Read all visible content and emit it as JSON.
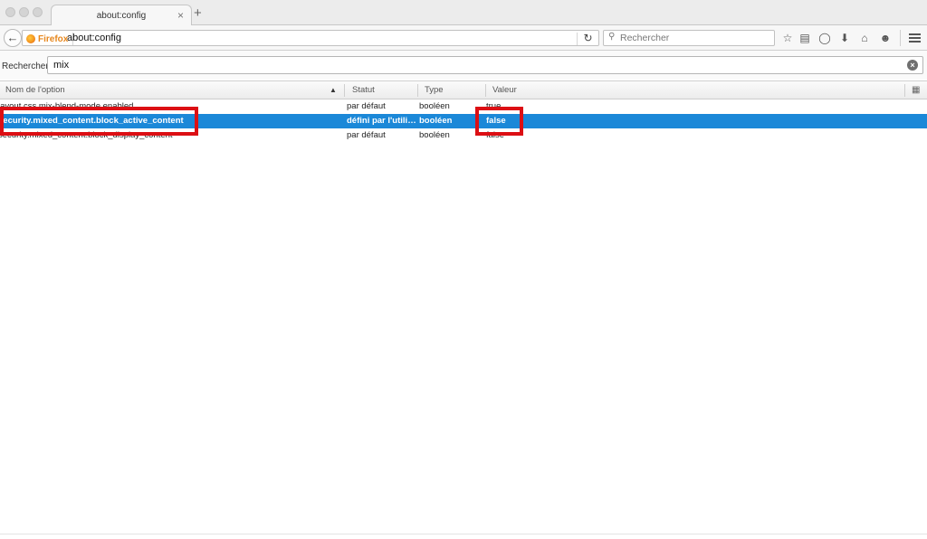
{
  "tab": {
    "title": "about:config",
    "close_glyph": "×",
    "new_tab_glyph": "+"
  },
  "navbar": {
    "identity_label": "Firefox",
    "url": "about:config",
    "search_placeholder": "Rechercher",
    "icons": [
      "back-arrow-icon",
      "reload-icon",
      "search-icon",
      "bookmark-star-icon",
      "reading-list-icon",
      "pocket-icon",
      "download-icon",
      "home-icon",
      "hello-icon",
      "hamburger-menu-icon"
    ]
  },
  "config": {
    "filter_label": "Rechercher :",
    "filter_value": "mix",
    "columns": {
      "name": "Nom de l'option",
      "status": "Statut",
      "type": "Type",
      "value": "Valeur"
    },
    "rows": [
      {
        "name": "layout.css.mix-blend-mode.enabled",
        "status": "par défaut",
        "type": "booléen",
        "value": "true",
        "selected": false
      },
      {
        "name": "security.mixed_content.block_active_content",
        "status": "défini par l'utilisateur",
        "type": "booléen",
        "value": "false",
        "selected": true
      },
      {
        "name": "security.mixed_content.block_display_content",
        "status": "par défaut",
        "type": "booléen",
        "value": "false",
        "selected": false
      }
    ]
  },
  "colors": {
    "selection": "#1b88d8",
    "highlight_box": "#dc0f14",
    "firefox_brand": "#e7871d"
  }
}
